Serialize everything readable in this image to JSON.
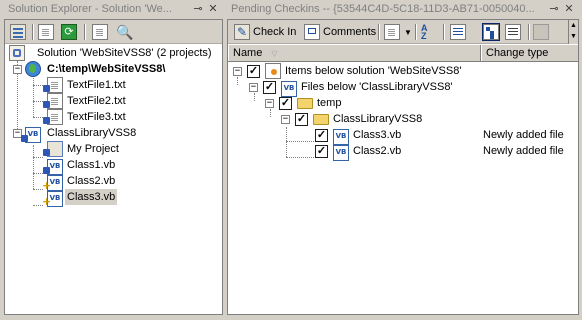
{
  "solution_explorer": {
    "title": "Solution Explorer - Solution 'We...",
    "items": {
      "solution": "Solution 'WebSiteVSS8' (2 projects)",
      "website": "C:\\temp\\WebSiteVSS8\\",
      "f1": "TextFile1.txt",
      "f2": "TextFile2.txt",
      "f3": "TextFile3.txt",
      "lib": "ClassLibraryVSS8",
      "myproj": "My Project",
      "c1": "Class1.vb",
      "c2": "Class2.vb",
      "c3": "Class3.vb"
    }
  },
  "pending_checkins": {
    "title": "Pending Checkins -- {53544C4D-5C18-11D3-AB71-0050040...",
    "toolbar": {
      "check_in": "Check In",
      "comments": "Comments"
    },
    "columns": {
      "name": "Name",
      "change_type": "Change type"
    },
    "items": {
      "sol": "Items below solution 'WebSiteVSS8'",
      "files": "Files below 'ClassLibraryVSS8'",
      "temp": "temp",
      "lib": "ClassLibraryVSS8",
      "c3": "Class3.vb",
      "c3_change": "Newly added file",
      "c2": "Class2.vb",
      "c2_change": "Newly added file"
    }
  },
  "colors": {
    "window_bg": "#d4d0c8",
    "selection_bg": "#d4d0c8",
    "folder": "#f3d36b",
    "vb_icon": "#1b4e9b"
  },
  "icons": [
    "properties-icon",
    "show-all-files-icon",
    "refresh-icon",
    "view-code-icon",
    "view-designer-icon",
    "check-in-icon",
    "comments-icon",
    "sort-icon",
    "flat-view-icon",
    "tree-view-icon",
    "folder-icon",
    "vb-file-icon",
    "text-file-icon",
    "solution-icon",
    "web-project-icon",
    "lock-icon",
    "plus-icon"
  ]
}
